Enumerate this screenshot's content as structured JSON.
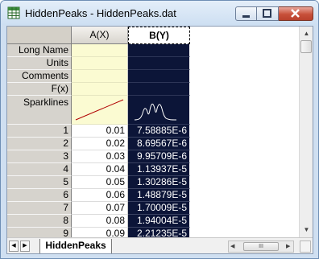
{
  "window": {
    "title": "HiddenPeaks - HiddenPeaks.dat",
    "icon": "worksheet-grid-icon"
  },
  "columns": [
    {
      "header": "A(X)",
      "selected": false
    },
    {
      "header": "B(Y)",
      "selected": true
    }
  ],
  "meta_rows": [
    "Long Name",
    "Units",
    "Comments",
    "F(x)",
    "Sparklines"
  ],
  "sparklines": {
    "A": "rising-line",
    "B": "multi-peak-curve"
  },
  "rows": [
    {
      "n": "1",
      "a": "0.01",
      "b": "7.58885E-6"
    },
    {
      "n": "2",
      "a": "0.02",
      "b": "8.69567E-6"
    },
    {
      "n": "3",
      "a": "0.03",
      "b": "9.95709E-6"
    },
    {
      "n": "4",
      "a": "0.04",
      "b": "1.13937E-5"
    },
    {
      "n": "5",
      "a": "0.05",
      "b": "1.30286E-5"
    },
    {
      "n": "6",
      "a": "0.06",
      "b": "1.48879E-5"
    },
    {
      "n": "7",
      "a": "0.07",
      "b": "1.70009E-5"
    },
    {
      "n": "8",
      "a": "0.08",
      "b": "1.94004E-5"
    },
    {
      "n": "9",
      "a": "0.09",
      "b": "2.21235E-5"
    }
  ],
  "sheet_tab": "HiddenPeaks",
  "colors": {
    "selected_column_bg": "#0c1538",
    "label_area_bg": "#fbfbd2"
  }
}
